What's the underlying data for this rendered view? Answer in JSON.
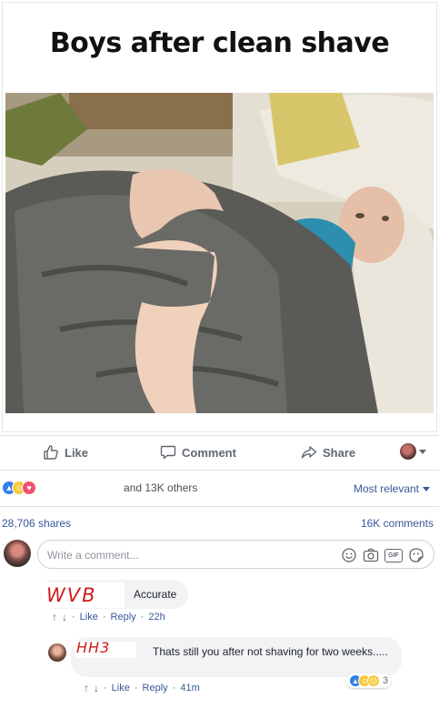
{
  "post": {
    "image_caption": "Boys after clean shave"
  },
  "actions": {
    "like": "Like",
    "comment": "Comment",
    "share": "Share"
  },
  "reactions": {
    "summary": "and 13K others",
    "sort_label": "Most relevant"
  },
  "stats": {
    "shares": "28,706 shares",
    "comments": "16K comments"
  },
  "composer": {
    "placeholder": "Write a comment..."
  },
  "comments": [
    {
      "scribble": "WVB",
      "text": "Accurate",
      "like": "Like",
      "reply": "Reply",
      "time": "22h"
    },
    {
      "scribble": "HH3",
      "text": "Thats still you after not shaving for two weeks.....",
      "like": "Like",
      "reply": "Reply",
      "time": "41m",
      "reaction_count": "3"
    }
  ],
  "colors": {
    "link": "#385898",
    "muted": "#606770",
    "like_blue": "#2f80ed",
    "love_red": "#f0506e",
    "haha_yellow": "#f7c93b",
    "scribble_red": "#d21a1a"
  }
}
